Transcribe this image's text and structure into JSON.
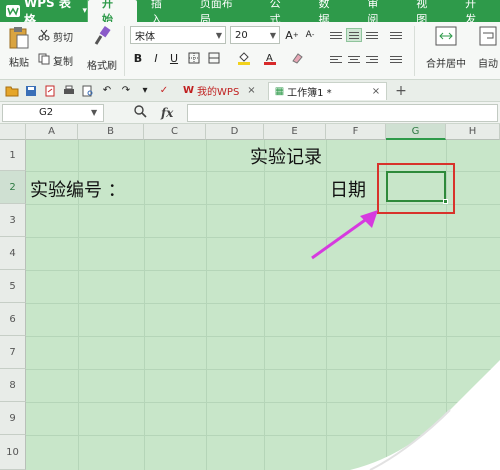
{
  "app": {
    "name": "WPS 表格"
  },
  "tabs": [
    {
      "label": "开始",
      "active": true
    },
    {
      "label": "插入",
      "active": false
    },
    {
      "label": "页面布局",
      "active": false
    },
    {
      "label": "公式",
      "active": false
    },
    {
      "label": "数据",
      "active": false
    },
    {
      "label": "审阅",
      "active": false
    },
    {
      "label": "视图",
      "active": false
    },
    {
      "label": "开发",
      "active": false
    }
  ],
  "ribbon": {
    "paste_label": "粘贴",
    "cut_label": "剪切",
    "copy_label": "复制",
    "format_painter_label": "格式刷",
    "font_name": "宋体",
    "font_size": "20",
    "bold": "B",
    "italic": "I",
    "underline": "U",
    "merge_label": "合并居中",
    "auto_label": "自动"
  },
  "quick_bar": {
    "tabs": [
      {
        "label": "我的WPS"
      },
      {
        "label": "工作簿1 *"
      }
    ]
  },
  "formula_bar": {
    "cell_ref": "G2",
    "fx_label": "fx",
    "value": ""
  },
  "sheet": {
    "columns": [
      "A",
      "B",
      "C",
      "D",
      "E",
      "F",
      "G",
      "H"
    ],
    "rows": [
      "1",
      "2",
      "3",
      "4",
      "5",
      "6",
      "7",
      "8",
      "9",
      "10"
    ],
    "selected_column": "G",
    "selected_row": "2",
    "cells": {
      "title": "实验记录",
      "exp_number_label": "实验编号 ：",
      "date_label": "日期"
    }
  },
  "colors": {
    "brand": "#2e9a4a",
    "sheet_bg": "#c8e6c9",
    "highlight_box": "#d8332b",
    "arrow": "#d63adf"
  }
}
